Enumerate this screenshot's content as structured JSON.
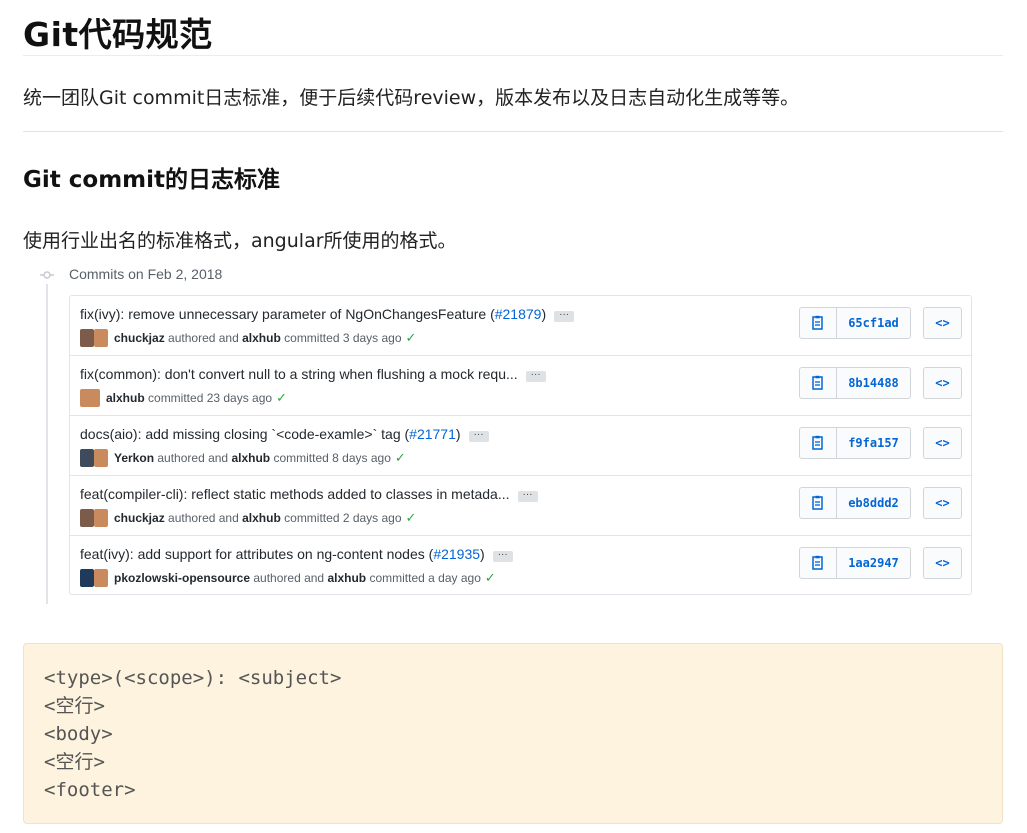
{
  "heading": "Git代码规范",
  "intro": "统一团队Git commit日志标准，便于后续代码review，版本发布以及日志自动化生成等等。",
  "section_heading": "Git commit的日志标准",
  "section_text": "使用行业出名的标准格式，angular所使用的格式。",
  "commit_list": {
    "date_label": "Commits on Feb 2, 2018",
    "commits": [
      {
        "message": "fix(ivy): remove unnecessary parameter of NgOnChangesFeature (",
        "pr": "#21879",
        "pr_close": ")",
        "author": "chuckjaz",
        "authored_text": "authored and",
        "committer": "alxhub",
        "committed_text": "committed 3 days ago",
        "sha": "65cf1ad",
        "avatar_colors": [
          "#7b5c4a",
          "#c98a5e"
        ]
      },
      {
        "message": "fix(common): don't convert null to a string when flushing a mock requ...",
        "pr": "",
        "pr_close": "",
        "author": "",
        "authored_text": "",
        "committer": "alxhub",
        "committed_text": "committed 23 days ago",
        "sha": "8b14488",
        "avatar_colors": [
          "#c98a5e"
        ]
      },
      {
        "message": "docs(aio): add missing closing `<code-examle>` tag (",
        "pr": "#21771",
        "pr_close": ")",
        "author": "Yerkon",
        "authored_text": "authored and",
        "committer": "alxhub",
        "committed_text": "committed 8 days ago",
        "sha": "f9fa157",
        "avatar_colors": [
          "#3d4b5c",
          "#c98a5e"
        ]
      },
      {
        "message": "feat(compiler-cli): reflect static methods added to classes in metada...",
        "pr": "",
        "pr_close": "",
        "author": "chuckjaz",
        "authored_text": "authored and",
        "committer": "alxhub",
        "committed_text": "committed 2 days ago",
        "sha": "eb8ddd2",
        "avatar_colors": [
          "#7b5c4a",
          "#c98a5e"
        ]
      },
      {
        "message": "feat(ivy): add support for attributes on ng-content nodes (",
        "pr": "#21935",
        "pr_close": ")",
        "author": "pkozlowski-opensource",
        "authored_text": "authored and",
        "committer": "alxhub",
        "committed_text": "committed a day ago",
        "sha": "1aa2947",
        "avatar_colors": [
          "#1f3a5a",
          "#c98a5e"
        ]
      }
    ],
    "ellipsis": "···",
    "check_glyph": "✓",
    "browse_glyph": "<>"
  },
  "code_block": [
    "<type>(<scope>): <subject>",
    "<空行>",
    "<body>",
    "<空行>",
    "<footer>"
  ]
}
